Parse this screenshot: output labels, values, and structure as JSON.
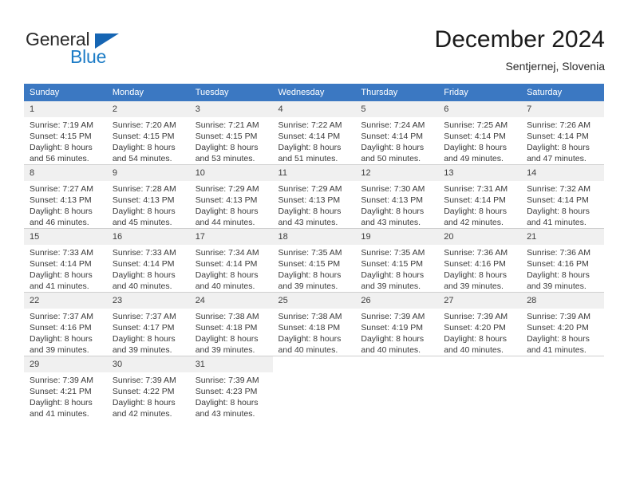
{
  "brand": {
    "name_top": "General",
    "name_bottom": "Blue",
    "accent_color": "#1d7cc6",
    "triangle_color": "#1665b3"
  },
  "header": {
    "month_title": "December 2024",
    "location": "Sentjernej, Slovenia"
  },
  "theme": {
    "header_blue": "#3b78c2",
    "daynum_band": "#f0f0f0",
    "grid_line": "#cfcfcf",
    "text": "#3a3a3a"
  },
  "weekday_headers": [
    "Sunday",
    "Monday",
    "Tuesday",
    "Wednesday",
    "Thursday",
    "Friday",
    "Saturday"
  ],
  "weeks": [
    [
      {
        "day": "1",
        "sunrise": "Sunrise: 7:19 AM",
        "sunset": "Sunset: 4:15 PM",
        "daylight": "Daylight: 8 hours",
        "daylight2": "and 56 minutes."
      },
      {
        "day": "2",
        "sunrise": "Sunrise: 7:20 AM",
        "sunset": "Sunset: 4:15 PM",
        "daylight": "Daylight: 8 hours",
        "daylight2": "and 54 minutes."
      },
      {
        "day": "3",
        "sunrise": "Sunrise: 7:21 AM",
        "sunset": "Sunset: 4:15 PM",
        "daylight": "Daylight: 8 hours",
        "daylight2": "and 53 minutes."
      },
      {
        "day": "4",
        "sunrise": "Sunrise: 7:22 AM",
        "sunset": "Sunset: 4:14 PM",
        "daylight": "Daylight: 8 hours",
        "daylight2": "and 51 minutes."
      },
      {
        "day": "5",
        "sunrise": "Sunrise: 7:24 AM",
        "sunset": "Sunset: 4:14 PM",
        "daylight": "Daylight: 8 hours",
        "daylight2": "and 50 minutes."
      },
      {
        "day": "6",
        "sunrise": "Sunrise: 7:25 AM",
        "sunset": "Sunset: 4:14 PM",
        "daylight": "Daylight: 8 hours",
        "daylight2": "and 49 minutes."
      },
      {
        "day": "7",
        "sunrise": "Sunrise: 7:26 AM",
        "sunset": "Sunset: 4:14 PM",
        "daylight": "Daylight: 8 hours",
        "daylight2": "and 47 minutes."
      }
    ],
    [
      {
        "day": "8",
        "sunrise": "Sunrise: 7:27 AM",
        "sunset": "Sunset: 4:13 PM",
        "daylight": "Daylight: 8 hours",
        "daylight2": "and 46 minutes."
      },
      {
        "day": "9",
        "sunrise": "Sunrise: 7:28 AM",
        "sunset": "Sunset: 4:13 PM",
        "daylight": "Daylight: 8 hours",
        "daylight2": "and 45 minutes."
      },
      {
        "day": "10",
        "sunrise": "Sunrise: 7:29 AM",
        "sunset": "Sunset: 4:13 PM",
        "daylight": "Daylight: 8 hours",
        "daylight2": "and 44 minutes."
      },
      {
        "day": "11",
        "sunrise": "Sunrise: 7:29 AM",
        "sunset": "Sunset: 4:13 PM",
        "daylight": "Daylight: 8 hours",
        "daylight2": "and 43 minutes."
      },
      {
        "day": "12",
        "sunrise": "Sunrise: 7:30 AM",
        "sunset": "Sunset: 4:13 PM",
        "daylight": "Daylight: 8 hours",
        "daylight2": "and 43 minutes."
      },
      {
        "day": "13",
        "sunrise": "Sunrise: 7:31 AM",
        "sunset": "Sunset: 4:14 PM",
        "daylight": "Daylight: 8 hours",
        "daylight2": "and 42 minutes."
      },
      {
        "day": "14",
        "sunrise": "Sunrise: 7:32 AM",
        "sunset": "Sunset: 4:14 PM",
        "daylight": "Daylight: 8 hours",
        "daylight2": "and 41 minutes."
      }
    ],
    [
      {
        "day": "15",
        "sunrise": "Sunrise: 7:33 AM",
        "sunset": "Sunset: 4:14 PM",
        "daylight": "Daylight: 8 hours",
        "daylight2": "and 41 minutes."
      },
      {
        "day": "16",
        "sunrise": "Sunrise: 7:33 AM",
        "sunset": "Sunset: 4:14 PM",
        "daylight": "Daylight: 8 hours",
        "daylight2": "and 40 minutes."
      },
      {
        "day": "17",
        "sunrise": "Sunrise: 7:34 AM",
        "sunset": "Sunset: 4:14 PM",
        "daylight": "Daylight: 8 hours",
        "daylight2": "and 40 minutes."
      },
      {
        "day": "18",
        "sunrise": "Sunrise: 7:35 AM",
        "sunset": "Sunset: 4:15 PM",
        "daylight": "Daylight: 8 hours",
        "daylight2": "and 39 minutes."
      },
      {
        "day": "19",
        "sunrise": "Sunrise: 7:35 AM",
        "sunset": "Sunset: 4:15 PM",
        "daylight": "Daylight: 8 hours",
        "daylight2": "and 39 minutes."
      },
      {
        "day": "20",
        "sunrise": "Sunrise: 7:36 AM",
        "sunset": "Sunset: 4:16 PM",
        "daylight": "Daylight: 8 hours",
        "daylight2": "and 39 minutes."
      },
      {
        "day": "21",
        "sunrise": "Sunrise: 7:36 AM",
        "sunset": "Sunset: 4:16 PM",
        "daylight": "Daylight: 8 hours",
        "daylight2": "and 39 minutes."
      }
    ],
    [
      {
        "day": "22",
        "sunrise": "Sunrise: 7:37 AM",
        "sunset": "Sunset: 4:16 PM",
        "daylight": "Daylight: 8 hours",
        "daylight2": "and 39 minutes."
      },
      {
        "day": "23",
        "sunrise": "Sunrise: 7:37 AM",
        "sunset": "Sunset: 4:17 PM",
        "daylight": "Daylight: 8 hours",
        "daylight2": "and 39 minutes."
      },
      {
        "day": "24",
        "sunrise": "Sunrise: 7:38 AM",
        "sunset": "Sunset: 4:18 PM",
        "daylight": "Daylight: 8 hours",
        "daylight2": "and 39 minutes."
      },
      {
        "day": "25",
        "sunrise": "Sunrise: 7:38 AM",
        "sunset": "Sunset: 4:18 PM",
        "daylight": "Daylight: 8 hours",
        "daylight2": "and 40 minutes."
      },
      {
        "day": "26",
        "sunrise": "Sunrise: 7:39 AM",
        "sunset": "Sunset: 4:19 PM",
        "daylight": "Daylight: 8 hours",
        "daylight2": "and 40 minutes."
      },
      {
        "day": "27",
        "sunrise": "Sunrise: 7:39 AM",
        "sunset": "Sunset: 4:20 PM",
        "daylight": "Daylight: 8 hours",
        "daylight2": "and 40 minutes."
      },
      {
        "day": "28",
        "sunrise": "Sunrise: 7:39 AM",
        "sunset": "Sunset: 4:20 PM",
        "daylight": "Daylight: 8 hours",
        "daylight2": "and 41 minutes."
      }
    ],
    [
      {
        "day": "29",
        "sunrise": "Sunrise: 7:39 AM",
        "sunset": "Sunset: 4:21 PM",
        "daylight": "Daylight: 8 hours",
        "daylight2": "and 41 minutes."
      },
      {
        "day": "30",
        "sunrise": "Sunrise: 7:39 AM",
        "sunset": "Sunset: 4:22 PM",
        "daylight": "Daylight: 8 hours",
        "daylight2": "and 42 minutes."
      },
      {
        "day": "31",
        "sunrise": "Sunrise: 7:39 AM",
        "sunset": "Sunset: 4:23 PM",
        "daylight": "Daylight: 8 hours",
        "daylight2": "and 43 minutes."
      },
      {
        "day": "",
        "sunrise": "",
        "sunset": "",
        "daylight": "",
        "daylight2": ""
      },
      {
        "day": "",
        "sunrise": "",
        "sunset": "",
        "daylight": "",
        "daylight2": ""
      },
      {
        "day": "",
        "sunrise": "",
        "sunset": "",
        "daylight": "",
        "daylight2": ""
      },
      {
        "day": "",
        "sunrise": "",
        "sunset": "",
        "daylight": "",
        "daylight2": ""
      }
    ]
  ]
}
